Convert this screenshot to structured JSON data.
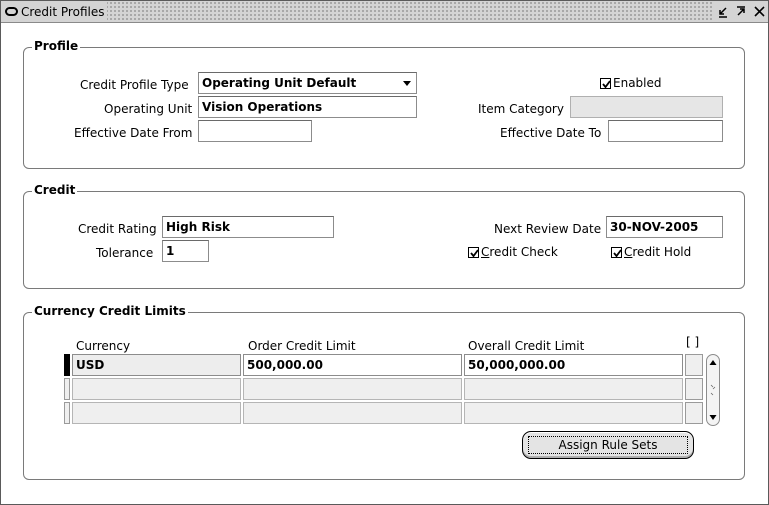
{
  "window": {
    "title": "Credit Profiles"
  },
  "profile": {
    "group_title": "Profile",
    "credit_profile_type_label": "Credit Profile Type",
    "credit_profile_type_value": "Operating Unit Default",
    "operating_unit_label": "Operating Unit",
    "operating_unit_value": "Vision Operations",
    "effective_date_from_label": "Effective Date From",
    "effective_date_from_value": "",
    "enabled_label": "Enabled",
    "enabled_checked": true,
    "item_category_label": "Item Category",
    "item_category_value": "",
    "effective_date_to_label": "Effective Date To",
    "effective_date_to_value": ""
  },
  "credit": {
    "group_title": "Credit",
    "credit_rating_label": "Credit Rating",
    "credit_rating_value": "High Risk",
    "tolerance_label": "Tolerance",
    "tolerance_value": "1",
    "next_review_date_label": "Next Review Date",
    "next_review_date_value": "30-NOV-2005",
    "credit_check_label_first": "C",
    "credit_check_label_rest": "redit Check",
    "credit_check_checked": true,
    "credit_hold_label_first": "C",
    "credit_hold_label_rest": "redit Hold",
    "credit_hold_checked": true
  },
  "limits": {
    "group_title": "Currency Credit Limits",
    "columns": {
      "currency": "Currency",
      "order_credit_limit": "Order Credit Limit",
      "overall_credit_limit": "Overall Credit Limit",
      "folder": "[ ]"
    },
    "rows": [
      {
        "currency": "USD",
        "order_credit_limit": "500,000.00",
        "overall_credit_limit": "50,000,000.00"
      },
      {
        "currency": "",
        "order_credit_limit": "",
        "overall_credit_limit": ""
      },
      {
        "currency": "",
        "order_credit_limit": "",
        "overall_credit_limit": ""
      }
    ],
    "assign_button": "Assign Rule Sets"
  }
}
